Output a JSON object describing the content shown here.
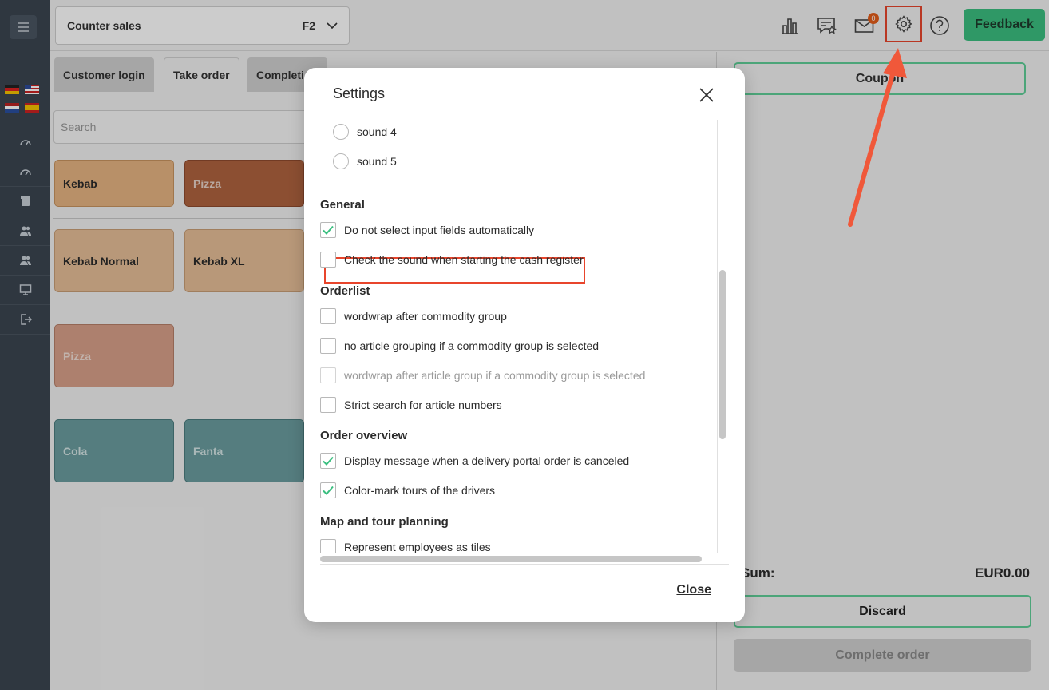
{
  "topbar": {
    "mode_label": "Counter sales",
    "mode_shortcut": "F2",
    "mail_count": "0",
    "feedback_label": "Feedback"
  },
  "tabs": [
    {
      "label": "Customer login"
    },
    {
      "label": "Take order"
    },
    {
      "label": "Completi"
    }
  ],
  "search": {
    "placeholder": "Search"
  },
  "tiles": [
    {
      "label": "Kebab"
    },
    {
      "label": "Pizza"
    },
    {
      "label": "Kebab Normal"
    },
    {
      "label": "Kebab XL"
    },
    {
      "label": "Pizza"
    },
    {
      "label": "Cola"
    },
    {
      "label": "Fanta"
    }
  ],
  "right_panel": {
    "coupon_label": "Coupon",
    "sum_label": "Sum:",
    "sum_value": "EUR0.00",
    "discard_label": "Discard",
    "complete_label": "Complete order"
  },
  "modal": {
    "title": "Settings",
    "close_label": "Close",
    "sounds": [
      {
        "label": "sound 4",
        "selected": false
      },
      {
        "label": "sound 5",
        "selected": false
      }
    ],
    "sections": [
      {
        "heading": "General",
        "options": [
          {
            "label": "Do not select input fields automatically",
            "checked": true,
            "disabled": false
          },
          {
            "label": "Check the sound when starting the cash register",
            "checked": false,
            "disabled": false
          }
        ]
      },
      {
        "heading": "Orderlist",
        "options": [
          {
            "label": "wordwrap after commodity group",
            "checked": false,
            "disabled": false
          },
          {
            "label": "no article grouping if a commodity group is selected",
            "checked": false,
            "disabled": false
          },
          {
            "label": "wordwrap after article group if a commodity group is selected",
            "checked": false,
            "disabled": true
          },
          {
            "label": "Strict search for article numbers",
            "checked": false,
            "disabled": false
          }
        ]
      },
      {
        "heading": "Order overview",
        "options": [
          {
            "label": "Display message when a delivery portal order is canceled",
            "checked": true,
            "disabled": false
          },
          {
            "label": "Color-mark tours of the drivers",
            "checked": true,
            "disabled": false
          }
        ]
      },
      {
        "heading": "Map and tour planning",
        "options": [
          {
            "label": "Represent employees as tiles",
            "checked": false,
            "disabled": false
          }
        ]
      }
    ]
  },
  "colors": {
    "accent_green": "#3bbf80",
    "check_green": "#3bbf80",
    "highlight_red": "#e8452c",
    "sidebar": "#3b4551"
  },
  "icons": [
    "menu-icon",
    "speedometer-icon",
    "bag-icon",
    "users-icon",
    "monitor-icon",
    "logout-icon",
    "chart-icon",
    "review-icon",
    "mail-icon",
    "gear-icon",
    "help-icon",
    "chevron-down-icon",
    "close-icon",
    "check-icon"
  ]
}
